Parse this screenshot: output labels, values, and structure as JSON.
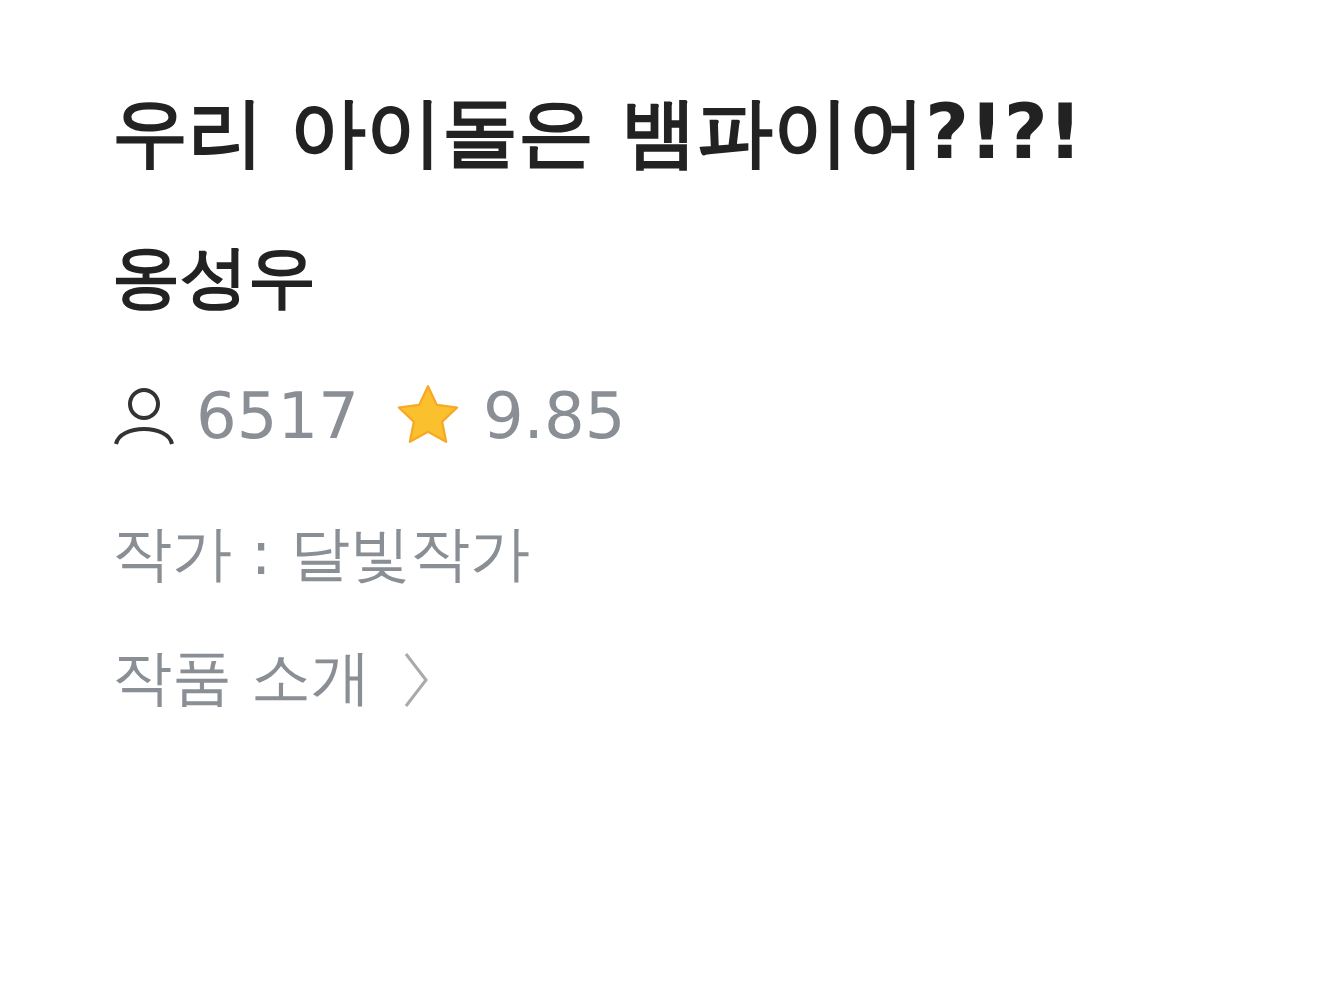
{
  "title": "우리 아이돌은 뱀파이어?!?!",
  "subtitle": "옹성우",
  "stats": {
    "readers": "6517",
    "rating": "9.85"
  },
  "author": "작가 : 달빛작가",
  "intro_link": "작품 소개"
}
